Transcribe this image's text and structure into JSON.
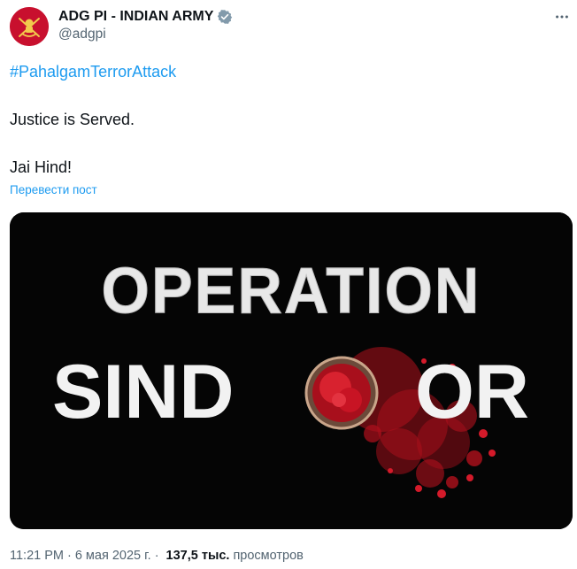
{
  "author": {
    "display_name": "ADG PI - INDIAN ARMY",
    "handle": "@adgpi",
    "verified": true,
    "avatar_icon": "army-emblem-icon",
    "avatar_color": "#c8102e"
  },
  "post": {
    "hashtag": "#PahalgamTerrorAttack",
    "line1": "Justice is Served.",
    "line2": "Jai Hind!",
    "translate_link": "Перевести пост"
  },
  "media": {
    "title_top": "OPERATION",
    "title_bottom_left": "SIND",
    "title_bottom_right": "OR",
    "bowl_color": "#c8102e"
  },
  "meta": {
    "time": "11:21 PM",
    "separator": "·",
    "date": "6 мая 2025 г.",
    "views_count": "137,5 тыс.",
    "views_label": "просмотров"
  },
  "colors": {
    "link": "#1d9bf0",
    "text": "#0f1419",
    "secondary": "#536471",
    "verified": "#829aab"
  }
}
